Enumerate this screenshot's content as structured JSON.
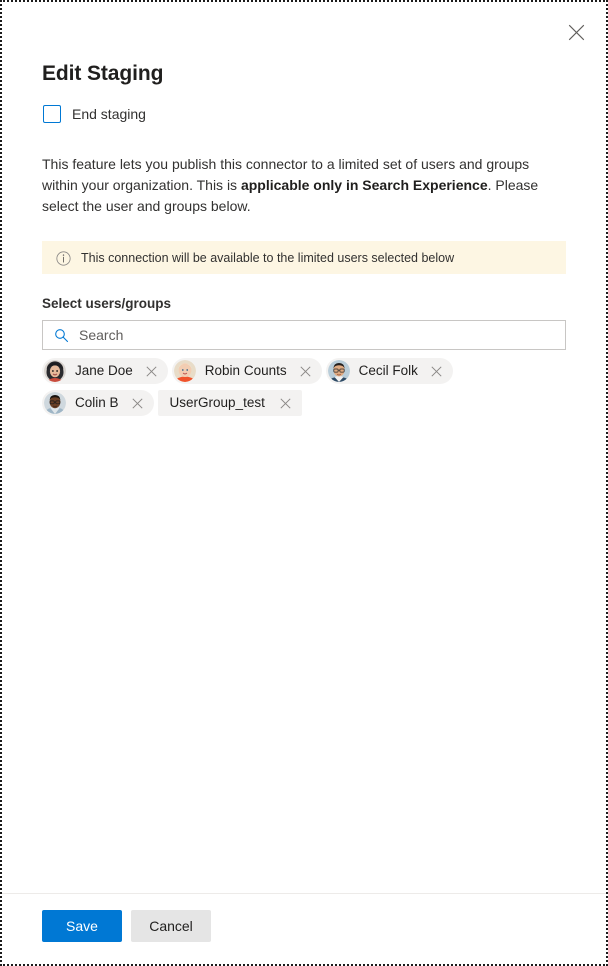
{
  "dialog": {
    "title": "Edit Staging",
    "close_label": "Close",
    "close_icon": "close-icon"
  },
  "end_staging": {
    "label": "End staging",
    "checked": false
  },
  "description": {
    "part1": "This feature lets you publish this connector to a limited set of users and groups within your organization. This is ",
    "emphasis": "applicable only in Search Experience",
    "part2": ". Please select the user and groups below."
  },
  "message_bar": {
    "icon": "info-icon",
    "text": "This connection will be available to the limited users selected below",
    "background_color": "#FDF6E3"
  },
  "people_picker": {
    "label": "Select users/groups",
    "search": {
      "icon": "search-icon",
      "placeholder": "Search",
      "value": ""
    },
    "selected": [
      {
        "name": "Jane Doe",
        "type": "person",
        "avatar": "photo-dark-hair-woman",
        "remove_icon": "close-icon"
      },
      {
        "name": "Robin Counts",
        "type": "person",
        "avatar": "photo-blonde-woman-orange",
        "remove_icon": "close-icon"
      },
      {
        "name": "Cecil Folk",
        "type": "person",
        "avatar": "photo-man-glasses-blue",
        "remove_icon": "close-icon"
      },
      {
        "name": "Colin B",
        "type": "person",
        "avatar": "photo-man-glasses-dark",
        "remove_icon": "close-icon"
      },
      {
        "name": "UserGroup_test",
        "type": "group",
        "avatar": null,
        "remove_icon": "close-icon"
      }
    ]
  },
  "footer": {
    "save_label": "Save",
    "cancel_label": "Cancel",
    "primary_color": "#0078D4"
  }
}
